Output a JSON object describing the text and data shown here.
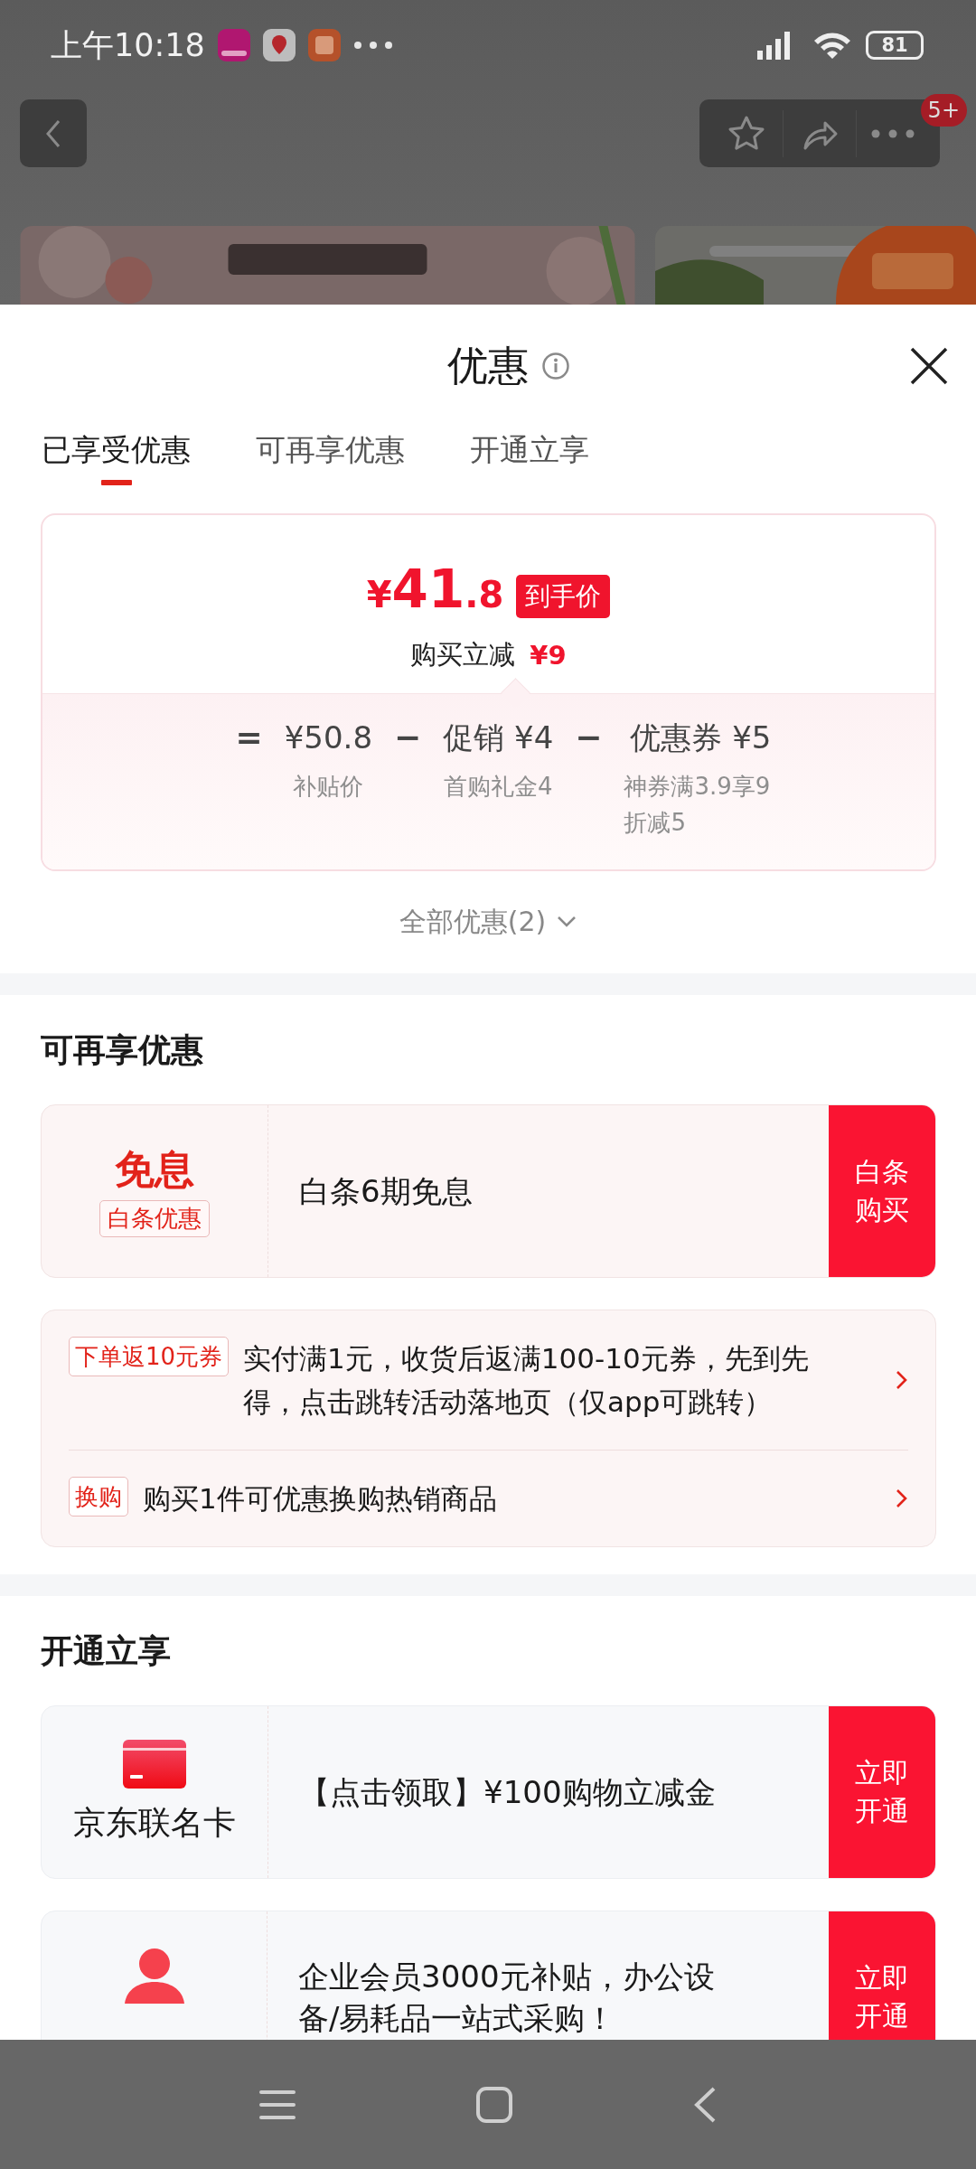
{
  "status_bar": {
    "time": "上午10:18",
    "battery": "81"
  },
  "top_bar": {
    "badge": "5+"
  },
  "sheet": {
    "title": "优惠",
    "tabs": [
      {
        "label": "已享受优惠",
        "selected": true
      },
      {
        "label": "可再享优惠",
        "selected": false
      },
      {
        "label": "开通立享",
        "selected": false
      }
    ],
    "summary": {
      "currency": "¥",
      "price_whole": "41",
      "price_fraction": ".8",
      "price_badge": "到手价",
      "saving_label": "购买立减",
      "saving_value": "¥9",
      "formula": [
        {
          "kind": "op",
          "text": "="
        },
        {
          "kind": "term",
          "value": "¥50.8",
          "note": "补贴价"
        },
        {
          "kind": "op",
          "text": "−"
        },
        {
          "kind": "term",
          "value": "促销 ¥4",
          "note": "首购礼金4"
        },
        {
          "kind": "op",
          "text": "−"
        },
        {
          "kind": "term",
          "value": "优惠券 ¥5",
          "note": "神券满3.9享9折减5"
        }
      ],
      "more_link": "全部优惠(2)"
    },
    "sections": [
      {
        "kind": "discount",
        "title": "可再享优惠",
        "cards": [
          {
            "kind": "offer",
            "left": {
              "kind": "badge",
              "headline": "免息",
              "tag": "白条优惠"
            },
            "text": "白条6期免息",
            "action": "白条购买"
          },
          {
            "kind": "list",
            "rows": [
              {
                "tag": "下单返10元券",
                "text": "实付满1元，收货后返满100-10元券，先到先得，点击跳转活动落地页（仅app可跳转）"
              },
              {
                "tag": "换购",
                "text": "购买1件可优惠换购热销商品"
              }
            ]
          }
        ]
      },
      {
        "kind": "membership",
        "title": "开通立享",
        "cards": [
          {
            "kind": "offer",
            "left": {
              "kind": "card",
              "headline": "京东联名卡"
            },
            "text": "【点击领取】¥100购物立减金",
            "action": "立即开通"
          },
          {
            "kind": "offer",
            "left": {
              "kind": "person"
            },
            "text": "企业会员3000元补贴，办公设备/易耗品一站式采购！",
            "action": "立即开通"
          }
        ]
      }
    ]
  }
}
